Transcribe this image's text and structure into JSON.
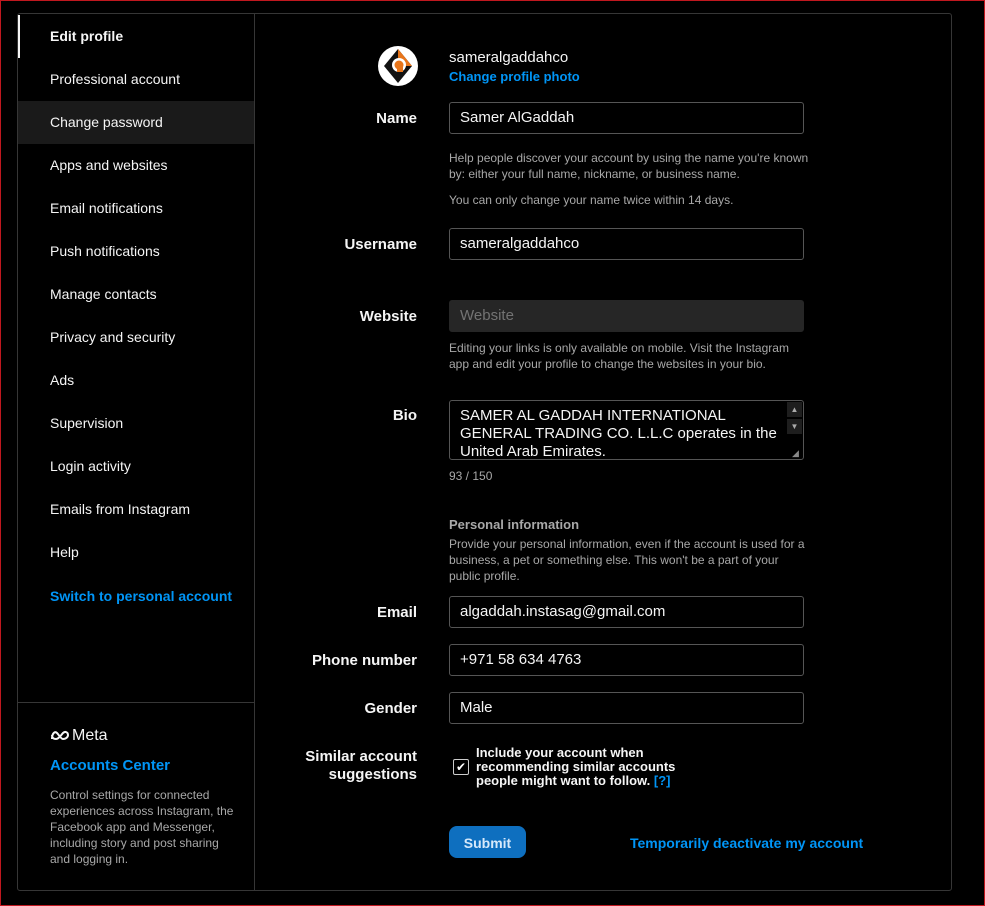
{
  "sidebar": {
    "items": [
      {
        "label": "Edit profile"
      },
      {
        "label": "Professional account"
      },
      {
        "label": "Change password"
      },
      {
        "label": "Apps and websites"
      },
      {
        "label": "Email notifications"
      },
      {
        "label": "Push notifications"
      },
      {
        "label": "Manage contacts"
      },
      {
        "label": "Privacy and security"
      },
      {
        "label": "Ads"
      },
      {
        "label": "Supervision"
      },
      {
        "label": "Login activity"
      },
      {
        "label": "Emails from Instagram"
      },
      {
        "label": "Help"
      }
    ],
    "switch_link": "Switch to personal account",
    "meta": {
      "logo_text": "Meta",
      "accounts_center": "Accounts Center",
      "description": "Control settings for connected experiences across Instagram, the Facebook app and Messenger, including story and post sharing and logging in."
    }
  },
  "profile": {
    "username": "sameralgaddahco",
    "change_photo": "Change profile photo"
  },
  "form": {
    "name_label": "Name",
    "name_value": "Samer AlGaddah",
    "name_help1": "Help people discover your account by using the name you're known by: either your full name, nickname, or business name.",
    "name_help2": "You can only change your name twice within 14 days.",
    "username_label": "Username",
    "username_value": "sameralgaddahco",
    "website_label": "Website",
    "website_placeholder": "Website",
    "website_help": "Editing your links is only available on mobile. Visit the Instagram app and edit your profile to change the websites in your bio.",
    "bio_label": "Bio",
    "bio_value": "SAMER AL GADDAH INTERNATIONAL GENERAL TRADING CO. L.L.C operates in the United Arab Emirates.",
    "bio_counter": "93 / 150",
    "personal_title": "Personal information",
    "personal_help": "Provide your personal information, even if the account is used for a business, a pet or something else. This won't be a part of your public profile.",
    "email_label": "Email",
    "email_value": "algaddah.instasag@gmail.com",
    "phone_label": "Phone number",
    "phone_value": "+971 58 634 4763",
    "gender_label": "Gender",
    "gender_value": "Male",
    "similar_label_1": "Similar account",
    "similar_label_2": "suggestions",
    "similar_checked": true,
    "similar_text": "Include your account when recommending similar accounts people might want to follow.",
    "similar_help_link": "[?]",
    "submit_label": "Submit",
    "deactivate_label": "Temporarily deactivate my account"
  },
  "colors": {
    "accent": "#0095f6",
    "submit_bg": "#0e6fbf",
    "background": "#000000",
    "border": "#363636"
  }
}
